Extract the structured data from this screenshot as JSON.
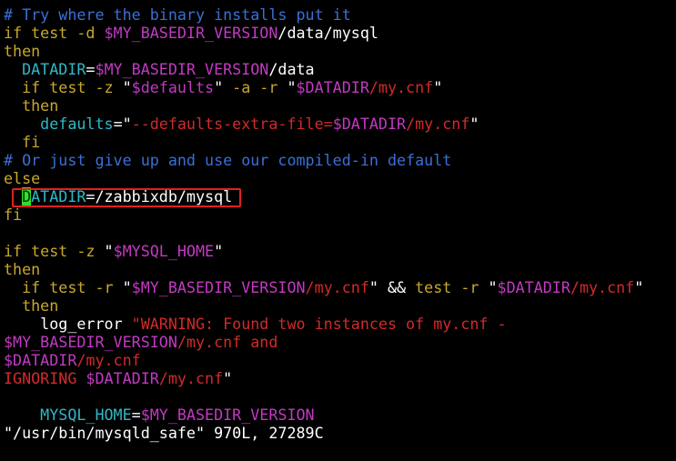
{
  "lines": [
    [
      {
        "t": "# Try where the binary installs put it",
        "c": "cm"
      }
    ],
    [
      {
        "t": "if test -d ",
        "c": "kw"
      },
      {
        "t": "$MY_BASEDIR_VERSION",
        "c": "mg"
      },
      {
        "t": "/data/mysql",
        "c": "wh"
      }
    ],
    [
      {
        "t": "then",
        "c": "kw"
      }
    ],
    [
      {
        "t": "  DATADIR",
        "c": "cy"
      },
      {
        "t": "=",
        "c": "wh"
      },
      {
        "t": "$MY_BASEDIR_VERSION",
        "c": "mg"
      },
      {
        "t": "/data",
        "c": "wh"
      }
    ],
    [
      {
        "t": "  if test -z ",
        "c": "kw"
      },
      {
        "t": "\"",
        "c": "wh"
      },
      {
        "t": "$defaults",
        "c": "mg"
      },
      {
        "t": "\"",
        "c": "wh"
      },
      {
        "t": " -a -r ",
        "c": "kw"
      },
      {
        "t": "\"",
        "c": "wh"
      },
      {
        "t": "$DATADIR",
        "c": "mg"
      },
      {
        "t": "/my.cnf",
        "c": "rd"
      },
      {
        "t": "\"",
        "c": "wh"
      }
    ],
    [
      {
        "t": "  then",
        "c": "kw"
      }
    ],
    [
      {
        "t": "    defaults",
        "c": "cy"
      },
      {
        "t": "=",
        "c": "wh"
      },
      {
        "t": "\"",
        "c": "wh"
      },
      {
        "t": "--defaults-extra-file=",
        "c": "rd"
      },
      {
        "t": "$DATADIR",
        "c": "mg"
      },
      {
        "t": "/my.cnf",
        "c": "rd"
      },
      {
        "t": "\"",
        "c": "wh"
      }
    ],
    [
      {
        "t": "  fi",
        "c": "kw"
      }
    ],
    [
      {
        "t": "# Or just give up and use our compiled-in default",
        "c": "cm"
      }
    ],
    [
      {
        "t": "else",
        "c": "kw"
      }
    ],
    [
      {
        "t": "  ",
        "c": "wh"
      },
      {
        "t": "D",
        "c": "cursor"
      },
      {
        "t": "ATADIR",
        "c": "cy"
      },
      {
        "t": "=/zabbixdb/mysql",
        "c": "wh"
      }
    ],
    [
      {
        "t": "fi",
        "c": "kw"
      }
    ],
    [
      {
        "t": "",
        "c": "wh"
      }
    ],
    [
      {
        "t": "if test -z ",
        "c": "kw"
      },
      {
        "t": "\"",
        "c": "wh"
      },
      {
        "t": "$MYSQL_HOME",
        "c": "mg"
      },
      {
        "t": "\"",
        "c": "wh"
      }
    ],
    [
      {
        "t": "then",
        "c": "kw"
      }
    ],
    [
      {
        "t": "  if test -r ",
        "c": "kw"
      },
      {
        "t": "\"",
        "c": "wh"
      },
      {
        "t": "$MY_BASEDIR_VERSION",
        "c": "mg"
      },
      {
        "t": "/my.cnf",
        "c": "rd"
      },
      {
        "t": "\"",
        "c": "wh"
      },
      {
        "t": " && ",
        "c": "wh"
      },
      {
        "t": "test -r ",
        "c": "kw"
      },
      {
        "t": "\"",
        "c": "wh"
      },
      {
        "t": "$DATADIR",
        "c": "mg"
      },
      {
        "t": "/my.cnf",
        "c": "rd"
      },
      {
        "t": "\"",
        "c": "wh"
      }
    ],
    [
      {
        "t": "  then",
        "c": "kw"
      }
    ],
    [
      {
        "t": "    log_error ",
        "c": "wh"
      },
      {
        "t": "\"WARNING: Found two instances of my.cnf -",
        "c": "rd"
      }
    ],
    [
      {
        "t": "$MY_BASEDIR_VERSION",
        "c": "mg"
      },
      {
        "t": "/my.cnf and",
        "c": "rd"
      }
    ],
    [
      {
        "t": "$DATADIR",
        "c": "mg"
      },
      {
        "t": "/my.cnf",
        "c": "rd"
      }
    ],
    [
      {
        "t": "IGNORING ",
        "c": "rd"
      },
      {
        "t": "$DATADIR",
        "c": "mg"
      },
      {
        "t": "/my.cnf",
        "c": "rd"
      },
      {
        "t": "\"",
        "c": "wh"
      }
    ],
    [
      {
        "t": "",
        "c": "wh"
      }
    ],
    [
      {
        "t": "    MYSQL_HOME",
        "c": "cy"
      },
      {
        "t": "=",
        "c": "wh"
      },
      {
        "t": "$MY_BASEDIR_VERSION",
        "c": "mg"
      }
    ],
    [
      {
        "t": "\"/usr/bin/mysqld_safe\" 970L, 27289C",
        "c": "wh"
      }
    ]
  ],
  "colors": {
    "background": "#000000",
    "comment": "#3b6fd6",
    "keyword": "#c8a82c",
    "variable": "#c23ac2",
    "string": "#d22a2a",
    "identifier": "#2fb8c8",
    "cursor": "#2ee02e",
    "highlight_box": "#e02020"
  }
}
